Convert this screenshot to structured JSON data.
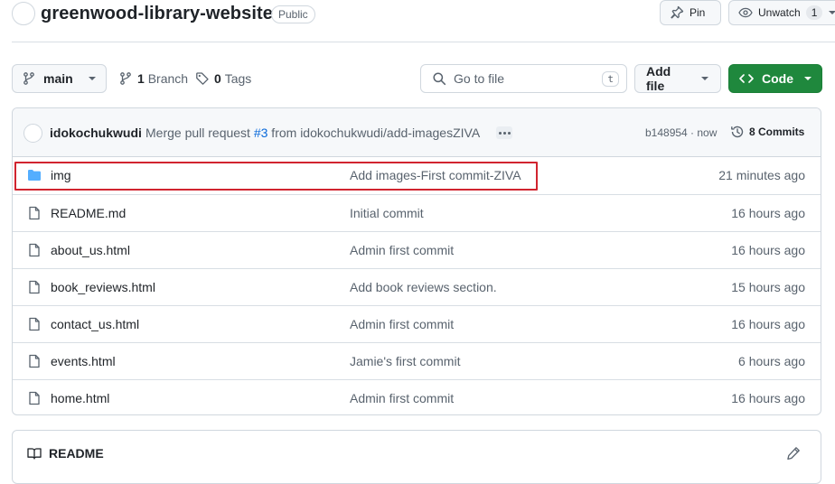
{
  "repo": {
    "name": "greenwood-library-website",
    "visibility": "Public"
  },
  "header_actions": {
    "pin_label": "Pin",
    "unwatch_label": "Unwatch",
    "watch_count": "1"
  },
  "toolbar": {
    "branch": "main",
    "branch_count_num": "1",
    "branch_count_label": "Branch",
    "tags_count_num": "0",
    "tags_count_label": "Tags",
    "goto_placeholder": "Go to file",
    "goto_shortcut": "t",
    "add_file_label": "Add file",
    "code_label": "Code"
  },
  "latest_commit": {
    "author": "idokochukwudi",
    "message_prefix": "Merge pull request ",
    "pr_number": "#3",
    "message_suffix": " from idokochukwudi/add-imagesZIVA",
    "sha_time": "b148954 · now",
    "commits_label": "8 Commits"
  },
  "files": [
    {
      "name": "img",
      "type": "folder",
      "message": "Add images-First commit-ZIVA",
      "time": "21 minutes ago",
      "highlighted": true
    },
    {
      "name": "README.md",
      "type": "file",
      "message": "Initial commit",
      "time": "16 hours ago"
    },
    {
      "name": "about_us.html",
      "type": "file",
      "message": "Admin first commit",
      "time": "16 hours ago"
    },
    {
      "name": "book_reviews.html",
      "type": "file",
      "message": "Add book reviews section.",
      "time": "15 hours ago"
    },
    {
      "name": "contact_us.html",
      "type": "file",
      "message": "Admin first commit",
      "time": "16 hours ago"
    },
    {
      "name": "events.html",
      "type": "file",
      "message": "Jamie's first commit",
      "time": "6 hours ago"
    },
    {
      "name": "home.html",
      "type": "file",
      "message": "Admin first commit",
      "time": "16 hours ago"
    }
  ],
  "readme": {
    "title": "README"
  },
  "colors": {
    "accent_green": "#1f883d",
    "folder_blue": "#54aeff",
    "link_blue": "#0969da",
    "highlight_red": "#d1242f"
  },
  "icons": [
    "repo-avatar",
    "pin-icon",
    "eye-icon",
    "branch-icon",
    "tag-icon",
    "search-icon",
    "code-icon",
    "folder-icon",
    "file-icon",
    "history-icon",
    "book-icon",
    "pencil-icon"
  ]
}
